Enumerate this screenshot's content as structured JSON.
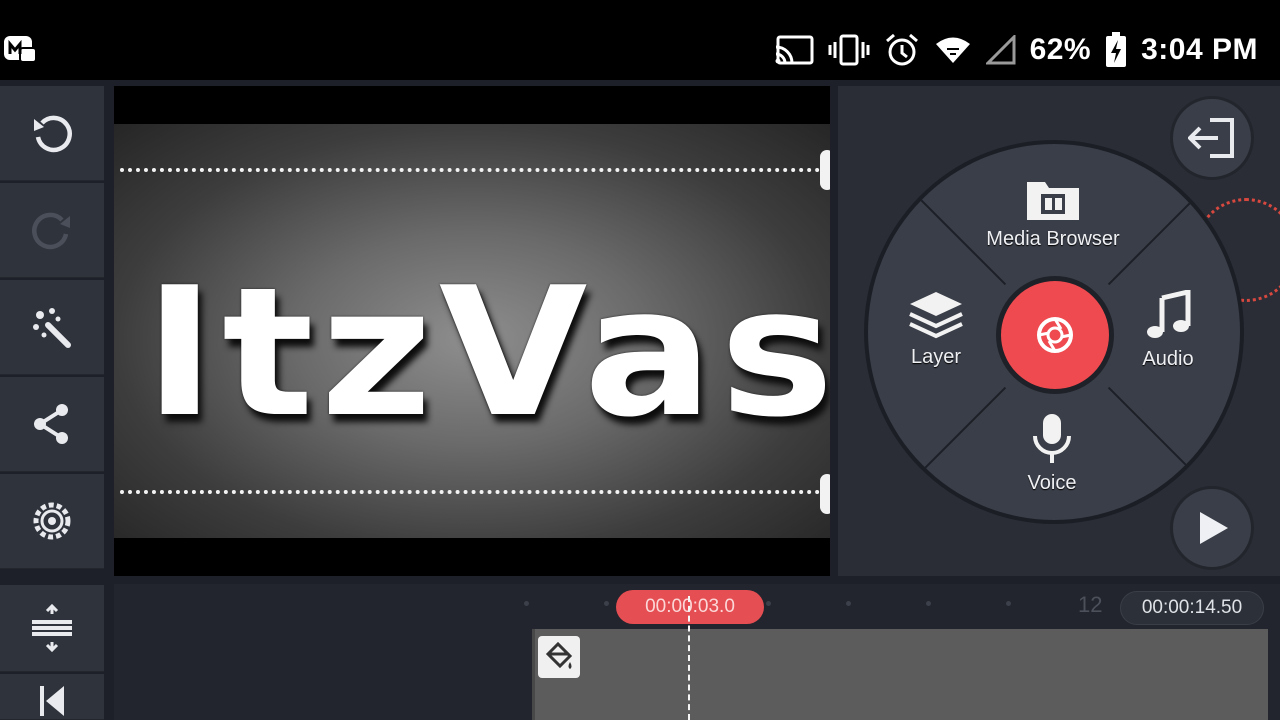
{
  "status_bar": {
    "battery": "62%",
    "time": "3:04 PM",
    "icons": [
      "app-logo-icon",
      "cast-icon",
      "vibrate-icon",
      "alarm-icon",
      "wifi-icon",
      "signal-icon",
      "battery-charging-icon"
    ]
  },
  "toolbar": {
    "items": [
      "undo-icon",
      "redo-icon",
      "effects-wand-icon",
      "share-icon",
      "settings-icon",
      "timeline-adjust-icon",
      "skip-start-icon"
    ]
  },
  "preview": {
    "title_text": "ItzVas"
  },
  "media_wheel": {
    "media_browser_label": "Media Browser",
    "layer_label": "Layer",
    "audio_label": "Audio",
    "voice_label": "Voice"
  },
  "timeline": {
    "current_time": "00:00:03.0",
    "ruler_mark": "12",
    "total_time": "00:00:14.50"
  },
  "colors": {
    "accent": "#ee4a4f",
    "panel": "#2f333c",
    "background": "#1d2029"
  }
}
